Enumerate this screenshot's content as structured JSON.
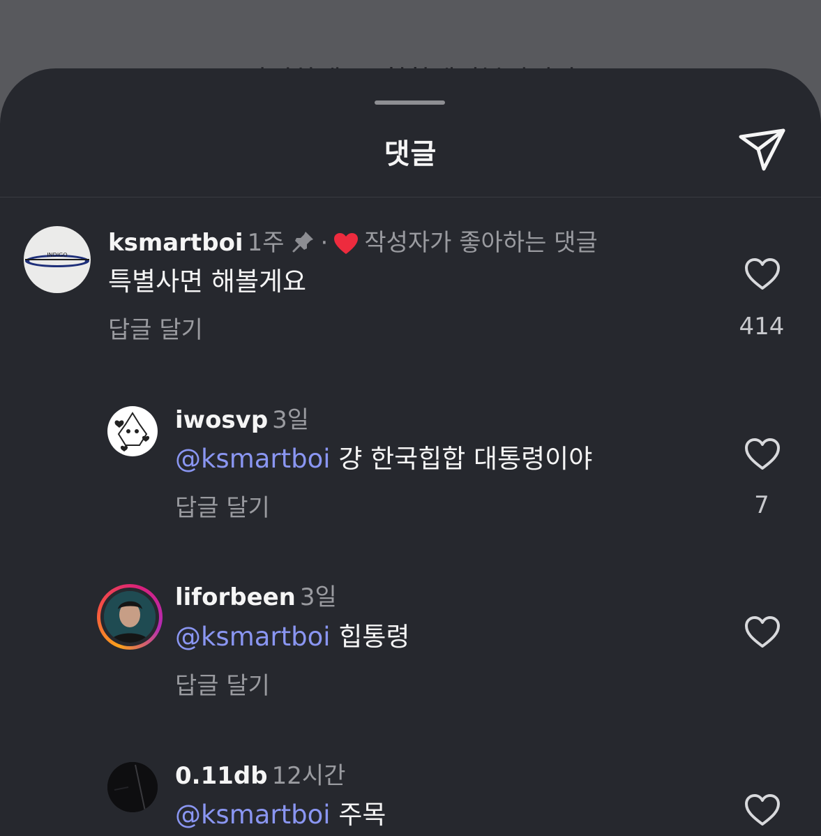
{
  "background_text": "안녕하세요. 힙합레이블입니다",
  "sheet": {
    "title": "댓글",
    "send_icon": "paper-plane-icon"
  },
  "comments": [
    {
      "username": "ksmartboi",
      "time": "1주",
      "pinned": true,
      "separator": "·",
      "liked_note": "작성자가 좋아하는 댓글",
      "avatar_logo_text": "INDIGO",
      "mention": "",
      "text": "특별사면 해볼게요",
      "reply_label": "답글 달기",
      "likes": "414"
    },
    {
      "username": "iwosvp",
      "time": "3일",
      "mention": "@ksmartboi",
      "text": "걍 한국힙합 대통령이야",
      "reply_label": "답글 달기",
      "likes": "7"
    },
    {
      "username": "liforbeen",
      "time": "3일",
      "story_ring": true,
      "mention": "@ksmartboi",
      "text": "힙통령",
      "reply_label": "답글 달기",
      "likes": ""
    },
    {
      "username": "0.11db",
      "time": "12시간",
      "mention": "@ksmartboi",
      "text": "주목",
      "reply_label": "",
      "likes": ""
    }
  ],
  "colors": {
    "sheet_bg": "#26282e",
    "mention": "#8a96f2",
    "heart_red": "#ed2b3e",
    "muted_text": "#9a9ba0"
  }
}
